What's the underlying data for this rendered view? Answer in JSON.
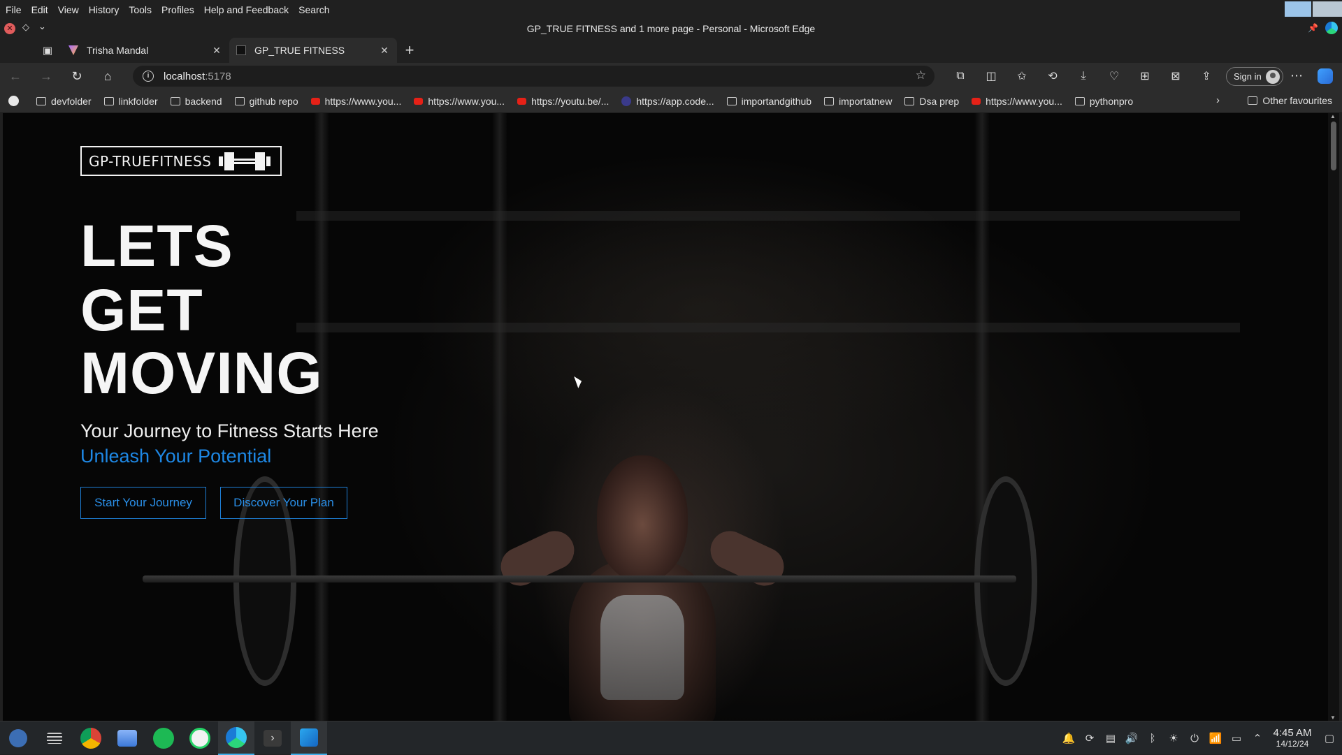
{
  "menubar": {
    "items": [
      "File",
      "Edit",
      "View",
      "History",
      "Tools",
      "Profiles",
      "Help and Feedback",
      "Search"
    ]
  },
  "window": {
    "title": "GP_TRUE FITNESS and 1 more page - Personal - Microsoft Edge"
  },
  "tabs": [
    {
      "label": "Trisha Mandal",
      "active": false
    },
    {
      "label": "GP_TRUE FITNESS",
      "active": true
    }
  ],
  "address": {
    "host": "localhost",
    "port": ":5178"
  },
  "toolbar": {
    "signin_label": "Sign in"
  },
  "bookmarks": {
    "items": [
      {
        "label": "devfolder",
        "icon": "folder-icon"
      },
      {
        "label": "linkfolder",
        "icon": "folder-icon"
      },
      {
        "label": "backend",
        "icon": "folder-icon"
      },
      {
        "label": "github repo",
        "icon": "folder-icon"
      },
      {
        "label": "https://www.you...",
        "icon": "youtube-icon"
      },
      {
        "label": "https://www.you...",
        "icon": "youtube-icon"
      },
      {
        "label": "https://youtu.be/...",
        "icon": "youtube-icon"
      },
      {
        "label": "https://app.code...",
        "icon": "codesandbox-icon"
      },
      {
        "label": "importandgithub",
        "icon": "folder-icon"
      },
      {
        "label": "importatnew",
        "icon": "folder-icon"
      },
      {
        "label": "Dsa prep",
        "icon": "folder-icon"
      },
      {
        "label": "https://www.you...",
        "icon": "youtube-icon"
      },
      {
        "label": "pythonpro",
        "icon": "folder-icon"
      }
    ],
    "other": "Other favourites"
  },
  "page": {
    "logo_text": "GP-TRUEFITNESS",
    "headline": [
      "LETS",
      "GET",
      "MOVING"
    ],
    "tagline": "Your Journey to Fitness Starts Here",
    "subtagline": "Unleash Your Potential",
    "cta_primary": "Start Your Journey",
    "cta_secondary": "Discover Your Plan",
    "accent_color": "#1e88e5"
  },
  "taskbar": {
    "apps": [
      "fedora-launcher-icon",
      "task-manager-icon",
      "chrome-icon",
      "files-icon",
      "spotify-icon",
      "whatsapp-icon",
      "edge-icon",
      "terminal-icon",
      "vscode-icon"
    ],
    "time": "4:45 AM",
    "date": "14/12/24"
  }
}
